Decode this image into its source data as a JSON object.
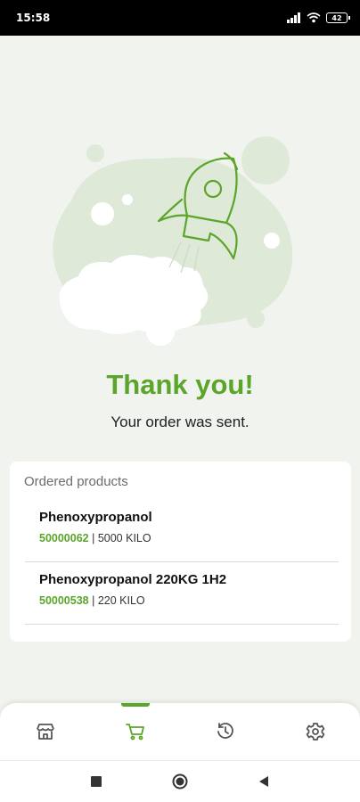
{
  "status_bar": {
    "time": "15:58",
    "battery_level": "42"
  },
  "confirmation": {
    "title": "Thank you!",
    "subtitle": "Your order was sent."
  },
  "ordered_products": {
    "heading": "Ordered products",
    "items": [
      {
        "name": "Phenoxypropanol",
        "code": "50000062",
        "details": "| 5000 KILO"
      },
      {
        "name": "Phenoxypropanol 220KG 1H2",
        "code": "50000538",
        "details": "| 220 KILO"
      }
    ]
  },
  "tab_bar": {
    "active_tab": "cart",
    "tabs": [
      "store-icon",
      "cart-icon",
      "history-icon",
      "settings-icon"
    ]
  },
  "colors": {
    "accent": "#5aa52a",
    "background": "#f1f3ef",
    "illustration_light": "#dfe9d8"
  }
}
